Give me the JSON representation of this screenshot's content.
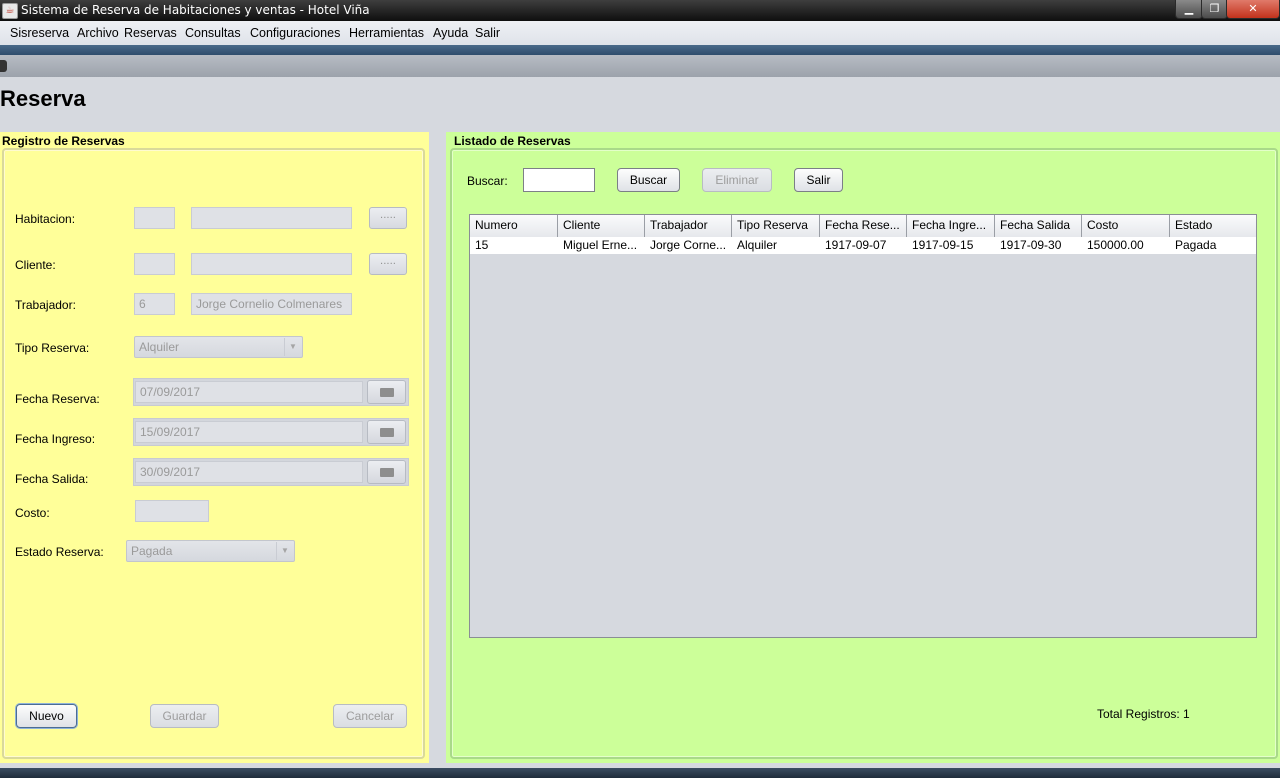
{
  "window": {
    "title": "Sistema de Reserva de Habitaciones y ventas - Hotel Viña"
  },
  "menu": {
    "items": [
      "Sisreserva",
      "Archivo",
      "Reservas",
      "Consultas",
      "Configuraciones",
      "Herramientas",
      "Ayuda",
      "Salir"
    ]
  },
  "page": {
    "heading": "Reserva"
  },
  "registro": {
    "title": "Registro de Reservas",
    "habitacion_label": "Habitacion:",
    "habitacion_id": "",
    "habitacion_desc": "",
    "cliente_label": "Cliente:",
    "cliente_id": "",
    "cliente_desc": "",
    "dots_label": ".....",
    "trabajador_label": "Trabajador:",
    "trabajador_id": "6",
    "trabajador_name": "Jorge Cornelio Colmenares",
    "tipo_label": "Tipo Reserva:",
    "tipo_value": "Alquiler",
    "fecha_reserva_label": "Fecha Reserva:",
    "fecha_reserva": "07/09/2017",
    "fecha_ingreso_label": "Fecha Ingreso:",
    "fecha_ingreso": "15/09/2017",
    "fecha_salida_label": "Fecha Salida:",
    "fecha_salida": "30/09/2017",
    "costo_label": "Costo:",
    "costo_value": "",
    "estado_label": "Estado Reserva:",
    "estado_value": "Pagada",
    "nuevo_label": "Nuevo",
    "guardar_label": "Guardar",
    "cancelar_label": "Cancelar"
  },
  "listado": {
    "title": "Listado de Reservas",
    "buscar_label": "Buscar:",
    "buscar_value": "",
    "buscar_btn": "Buscar",
    "eliminar_btn": "Eliminar",
    "salir_btn": "Salir",
    "columns": [
      "Numero",
      "Cliente",
      "Trabajador",
      "Tipo Reserva",
      "Fecha Rese...",
      "Fecha Ingre...",
      "Fecha Salida",
      "Costo",
      "Estado"
    ],
    "rows": [
      [
        "15",
        "Miguel Erne...",
        "Jorge Corne...",
        "Alquiler",
        "1917-09-07",
        "1917-09-15",
        "1917-09-30",
        "150000.00",
        "Pagada"
      ]
    ],
    "total_label": "Total Registros: 1"
  }
}
